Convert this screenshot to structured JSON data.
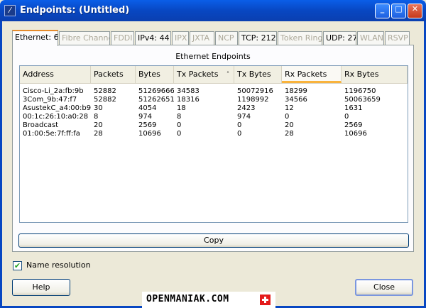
{
  "window": {
    "title": "Endpoints: (Untitled)"
  },
  "tabs": [
    {
      "label": "Ethernet: 6",
      "state": "active"
    },
    {
      "label": "Fibre Channel",
      "state": "disabled"
    },
    {
      "label": "FDDI",
      "state": "disabled"
    },
    {
      "label": "IPv4: 44",
      "state": "enabled"
    },
    {
      "label": "IPX",
      "state": "disabled"
    },
    {
      "label": "JXTA",
      "state": "disabled"
    },
    {
      "label": "NCP",
      "state": "disabled"
    },
    {
      "label": "TCP: 212",
      "state": "enabled"
    },
    {
      "label": "Token Ring",
      "state": "disabled"
    },
    {
      "label": "UDP: 27",
      "state": "enabled"
    },
    {
      "label": "WLAN",
      "state": "disabled"
    },
    {
      "label": "RSVP",
      "state": "disabled"
    }
  ],
  "panel": {
    "title": "Ethernet Endpoints"
  },
  "table": {
    "columns": [
      "Address",
      "Packets",
      "Bytes",
      "Tx Packets",
      "Tx Bytes",
      "Rx Packets",
      "Rx Bytes"
    ],
    "sort_column": "Tx Packets",
    "sort_direction": "descending",
    "sort_indicator": "˄",
    "hot_column": "Rx Packets",
    "rows": [
      [
        "Cisco-Li_2a:fb:9b",
        "52882",
        "51269666",
        "34583",
        "50072916",
        "18299",
        "1196750"
      ],
      [
        "3Com_9b:47:f7",
        "52882",
        "51262651",
        "18316",
        "1198992",
        "34566",
        "50063659"
      ],
      [
        "AsustekC_a4:00:b9",
        "30",
        "4054",
        "18",
        "2423",
        "12",
        "1631"
      ],
      [
        "00:1c:26:10:a0:28",
        "8",
        "974",
        "8",
        "974",
        "0",
        "0"
      ],
      [
        "Broadcast",
        "20",
        "2569",
        "0",
        "0",
        "20",
        "2569"
      ],
      [
        "01:00:5e:7f:ff:fa",
        "28",
        "10696",
        "0",
        "0",
        "28",
        "10696"
      ]
    ]
  },
  "buttons": {
    "copy": "Copy",
    "help": "Help",
    "close": "Close"
  },
  "options": {
    "name_resolution_label": "Name resolution",
    "name_resolution_checked": true,
    "check_glyph": "✔"
  },
  "watermark": {
    "text": "OPENMANIAK.COM"
  },
  "titlebar_buttons": {
    "minimize": "_",
    "maximize": "□",
    "close": "✕"
  },
  "app_icon_glyph": "⁄",
  "colors": {
    "titlebar": "#0847c2",
    "tab_accent": "#e68b2c",
    "hot_column": "#f9b33c",
    "flag": "#e41b1b"
  }
}
